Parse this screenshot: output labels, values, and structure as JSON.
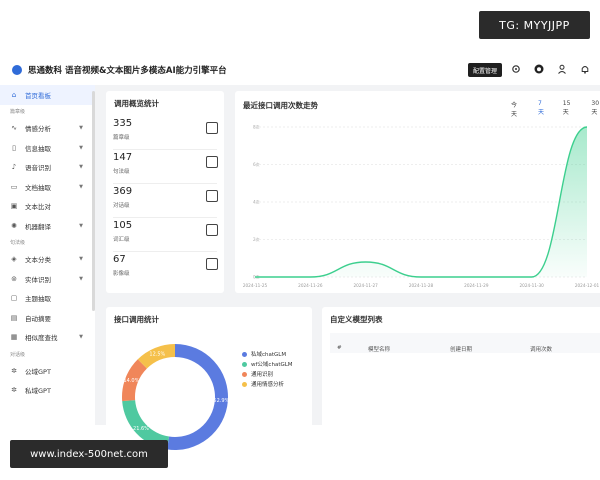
{
  "overlay": {
    "tg": "TG: MYYJJPP",
    "url": "www.index-500net.com"
  },
  "header": {
    "brand": "思通数科 语音视频&文本图片多模态AI能力引擎平台",
    "tooltip": "配置管理"
  },
  "sidebar": {
    "items": [
      {
        "label": "首页看板",
        "icon": "home-icon",
        "glyph": "⌂",
        "active": true
      },
      {
        "group": "篇章级"
      },
      {
        "label": "情感分析",
        "icon": "pulse-icon",
        "glyph": "∿",
        "chevron": true
      },
      {
        "label": "信息抽取",
        "icon": "bookmark-icon",
        "glyph": "▯",
        "chevron": true
      },
      {
        "label": "语音识别",
        "icon": "mic-icon",
        "glyph": "♪",
        "chevron": true
      },
      {
        "label": "文档抽取",
        "icon": "doc-icon",
        "glyph": "▭",
        "chevron": true
      },
      {
        "label": "文本比对",
        "icon": "compare-icon",
        "glyph": "▣"
      },
      {
        "label": "机器翻译",
        "icon": "translate-icon",
        "glyph": "✺",
        "chevron": true
      },
      {
        "group": "句法级"
      },
      {
        "label": "文本分类",
        "icon": "layers-icon",
        "glyph": "◈",
        "chevron": true
      },
      {
        "label": "实体识别",
        "icon": "tag-icon",
        "glyph": "⊚",
        "chevron": true
      },
      {
        "label": "主题抽取",
        "icon": "cube-icon",
        "glyph": "▢"
      },
      {
        "label": "自动摘要",
        "icon": "summary-icon",
        "glyph": "▤"
      },
      {
        "label": "相似度查找",
        "icon": "grid-icon",
        "glyph": "▦",
        "chevron": true
      },
      {
        "group": "对话级"
      },
      {
        "label": "公域GPT",
        "icon": "gpt-icon",
        "glyph": "✲"
      },
      {
        "label": "私域GPT",
        "icon": "gpt-private-icon",
        "glyph": "✲"
      }
    ]
  },
  "overview": {
    "title": "调用概览统计",
    "stats": [
      {
        "value": "335",
        "label": "篇章级",
        "icon": "book-icon"
      },
      {
        "value": "147",
        "label": "句法级",
        "icon": "file-icon"
      },
      {
        "value": "369",
        "label": "对话级",
        "icon": "chat-icon"
      },
      {
        "value": "105",
        "label": "词汇级",
        "icon": "tag-icon"
      },
      {
        "value": "67",
        "label": "影像级",
        "icon": "image-icon"
      }
    ]
  },
  "trend": {
    "title": "最近接口调用次数走势",
    "tabs": [
      {
        "label": "今天"
      },
      {
        "label": "7天",
        "selected": true
      },
      {
        "label": "15天"
      },
      {
        "label": "30天"
      }
    ]
  },
  "api_stats": {
    "title": "接口调用统计",
    "legend": [
      {
        "name": "私域chatGLM",
        "color": "#5b7be0"
      },
      {
        "name": "wf公域chatGLM",
        "color": "#4fc9a0"
      },
      {
        "name": "通用识别",
        "color": "#f0865a"
      },
      {
        "name": "通用情感分析",
        "color": "#f5c04a"
      }
    ],
    "slice_labels": [
      "52.9%",
      "21.6%",
      "14.0%",
      "12.5%"
    ]
  },
  "custom_models": {
    "title": "自定义模型列表",
    "columns": [
      "#",
      "模型名称",
      "创建日期",
      "调用次数"
    ]
  },
  "chart_data": [
    {
      "type": "area",
      "title": "最近接口调用次数走势",
      "x": [
        "2024-11-25",
        "2024-11-26",
        "2024-11-27",
        "2024-11-28",
        "2024-11-29",
        "2024-11-30",
        "2024-12-01"
      ],
      "values": [
        0,
        0,
        0.8,
        0,
        0,
        0,
        8.5
      ],
      "y_ticks": [
        "8次",
        "6次",
        "4次",
        "2次",
        "0次"
      ],
      "ylim": [
        0,
        8
      ],
      "color": "#3ccf8e",
      "grid": true
    },
    {
      "type": "pie",
      "title": "接口调用统计",
      "categories": [
        "私域chatGLM",
        "wf公域chatGLM",
        "通用识别",
        "通用情感分析"
      ],
      "values": [
        52.9,
        21.6,
        14.0,
        12.5
      ],
      "colors": [
        "#5b7be0",
        "#4fc9a0",
        "#f0865a",
        "#f5c04a"
      ],
      "legend": "right"
    }
  ]
}
